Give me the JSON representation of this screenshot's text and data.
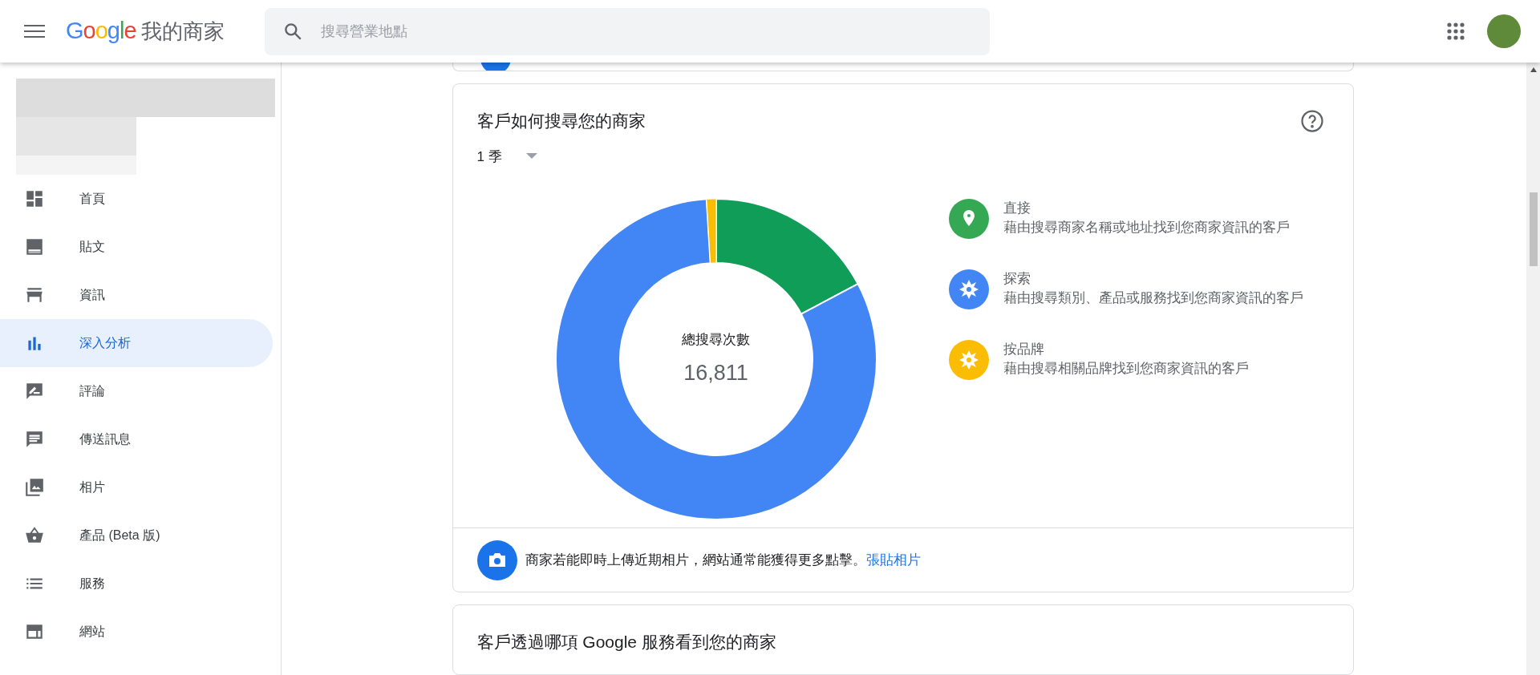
{
  "header": {
    "logo": "Google",
    "app_title": "我的商家",
    "search": {
      "placeholder": "搜尋營業地點"
    }
  },
  "sidebar": {
    "items": [
      {
        "label": "首頁",
        "selected": false
      },
      {
        "label": "貼文",
        "selected": false
      },
      {
        "label": "資訊",
        "selected": false
      },
      {
        "label": "深入分析",
        "selected": true
      },
      {
        "label": "評論",
        "selected": false
      },
      {
        "label": "傳送訊息",
        "selected": false
      },
      {
        "label": "相片",
        "selected": false
      },
      {
        "label": "產品 (Beta 版)",
        "selected": false
      },
      {
        "label": "服務",
        "selected": false
      },
      {
        "label": "網站",
        "selected": false
      }
    ]
  },
  "search_card": {
    "title": "客戶如何搜尋您的商家",
    "period": "1 季",
    "total_label": "總搜尋次數",
    "total_value": "16,811",
    "legend": [
      {
        "title": "直接",
        "description": "藉由搜尋商家名稱或地址找到您商家資訊的客戶",
        "color": "#34a853"
      },
      {
        "title": "探索",
        "description": "藉由搜尋類別、產品或服務找到您商家資訊的客戶",
        "color": "#4285f4"
      },
      {
        "title": "按品牌",
        "description": "藉由搜尋相關品牌找到您商家資訊的客戶",
        "color": "#fbbc04"
      }
    ],
    "tip": {
      "text": "商家若能即時上傳近期相片，網站通常能獲得更多點擊。",
      "link": "張貼相片"
    }
  },
  "next_card": {
    "title": "客戶透過哪項 Google 服務看到您的商家"
  }
}
